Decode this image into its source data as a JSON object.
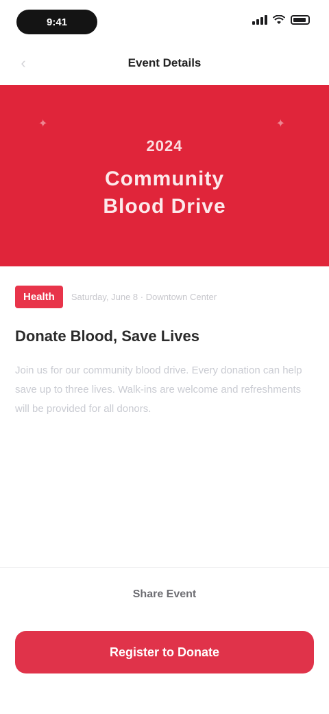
{
  "status_bar": {
    "time": "9:41"
  },
  "nav": {
    "title": "Event Details"
  },
  "hero": {
    "kicker": "2024",
    "line1": "Community",
    "line2": "Blood Drive"
  },
  "article": {
    "tag": "Health",
    "meta": "Saturday, June 8 · Downtown Center",
    "title": "Donate Blood, Save Lives",
    "description": "Join us for our community blood drive. Every donation can help save up to three lives. Walk-ins are welcome and refreshments will be provided for all donors."
  },
  "footer": {
    "secondary_label": "Share Event",
    "primary_label": "Register to Donate"
  },
  "colors": {
    "brand_red": "#e0253a",
    "tag_red": "#e8344a"
  }
}
